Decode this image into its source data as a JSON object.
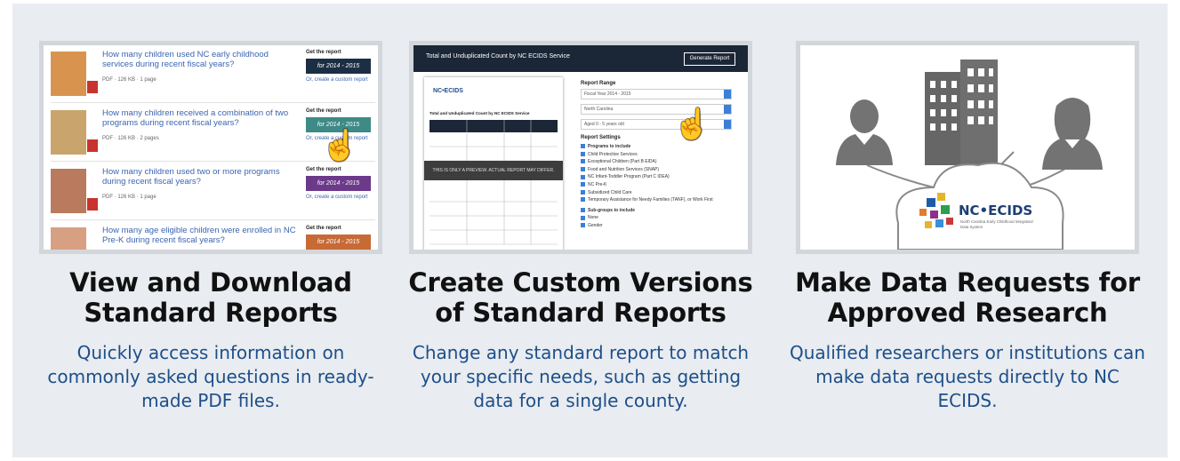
{
  "cards": [
    {
      "title": "View and Download\nStandard Reports",
      "description": "Quickly access information on commonly asked questions in ready-made PDF files.",
      "thumbnail": {
        "reports": [
          {
            "question": "How many children used NC early childhood services during recent fiscal years?",
            "meta": "PDF · 126 KB · 1 page",
            "get_label": "Get the report",
            "button": "for 2014 - 2015",
            "button_color": "#1c2e44",
            "custom_link": "Or, create a custom report"
          },
          {
            "question": "How many children received a combination of two programs during recent fiscal years?",
            "meta": "PDF · 126 KB · 2 pages",
            "get_label": "Get the report",
            "button": "for 2014 - 2015",
            "button_color": "#3d8a86",
            "custom_link": "Or, create a custom report"
          },
          {
            "question": "How many children used two or more programs during recent fiscal years?",
            "meta": "PDF · 126 KB · 1 page",
            "get_label": "Get the report",
            "button": "for 2014 - 2015",
            "button_color": "#6c3a8a",
            "custom_link": "Or, create a custom report"
          },
          {
            "question": "How many age eligible children were enrolled in NC Pre-K during recent fiscal years?",
            "meta": "",
            "get_label": "Get the report",
            "button": "for 2014 - 2015",
            "button_color": "#c86a35",
            "custom_link": ""
          }
        ]
      }
    },
    {
      "title": "Create Custom Versions\nof Standard Reports",
      "description": "Change any standard report to match your specific needs, such as getting data for a single county.",
      "thumbnail": {
        "header_title": "Total and Unduplicated Count by NC ECIDS Service",
        "generate_button": "Generate Report",
        "paper_title": "Total and Unduplicated Count by NC ECIDS Service",
        "paper_logo": "NC•ECIDS",
        "preview_notice": "THIS IS ONLY A PREVIEW. ACTUAL REPORT MAY DIFFER.",
        "report_range_label": "Report Range",
        "selects": [
          "Fiscal Year 2014 - 2015",
          "North Carolina",
          "Aged 0 - 5 years old"
        ],
        "report_settings_label": "Report Settings",
        "programs_label": "Programs to include",
        "programs": [
          "Child Protective Services",
          "Exceptional Children (Part B EIDA)",
          "Food and Nutrition Services (SNAP)",
          "NC Infant-Toddler Program (Part C IDEA)",
          "NC Pre-K",
          "Subsidized Child Care",
          "Temporary Assistance for Needy Families (TANF), or Work First"
        ],
        "subgroups_label": "Sub-groups to include",
        "subgroups": [
          "None",
          "Gender"
        ]
      }
    },
    {
      "title": "Make Data Requests for\nApproved Research",
      "description": "Qualified researchers or institutions can make data requests directly to NC ECIDS.",
      "thumbnail": {
        "logo_text": "NC•ECIDS",
        "logo_subtitle": "North Carolina Early Childhood Integrated Data System"
      }
    }
  ]
}
